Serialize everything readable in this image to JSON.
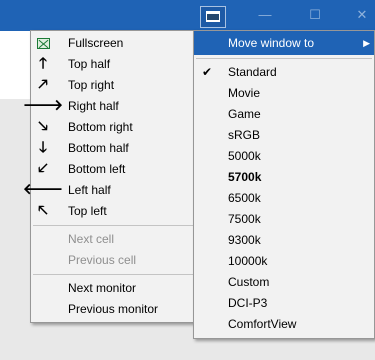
{
  "left_menu": {
    "items": [
      {
        "label": "Fullscreen",
        "icon": "fullscreen-icon"
      },
      {
        "label": "Top half",
        "icon": "arrow-up-icon"
      },
      {
        "label": "Top right",
        "icon": "arrow-up-right-icon"
      },
      {
        "label": "Right half",
        "icon": "arrow-right-icon"
      },
      {
        "label": "Bottom right",
        "icon": "arrow-down-right-icon"
      },
      {
        "label": "Bottom half",
        "icon": "arrow-down-icon"
      },
      {
        "label": "Bottom left",
        "icon": "arrow-down-left-icon"
      },
      {
        "label": "Left half",
        "icon": "arrow-left-icon"
      },
      {
        "label": "Top left",
        "icon": "arrow-up-left-icon"
      },
      {
        "label": "Next cell",
        "disabled": true
      },
      {
        "label": "Previous cell",
        "disabled": true
      },
      {
        "label": "Next monitor"
      },
      {
        "label": "Previous monitor"
      }
    ]
  },
  "right_menu": {
    "header": "Move window to",
    "items": [
      {
        "label": "Standard",
        "checked": true
      },
      {
        "label": "Movie"
      },
      {
        "label": "Game"
      },
      {
        "label": "sRGB"
      },
      {
        "label": "5000k"
      },
      {
        "label": "5700k",
        "bold": true
      },
      {
        "label": "6500k"
      },
      {
        "label": "7500k"
      },
      {
        "label": "9300k"
      },
      {
        "label": "10000k"
      },
      {
        "label": "Custom"
      },
      {
        "label": "DCI-P3"
      },
      {
        "label": "ComfortView"
      }
    ]
  },
  "colors": {
    "highlight": "#1f63b5",
    "menu_bg": "#f2f2f2",
    "disabled_text": "#8f8f8f",
    "icon_green": "#1b7a36"
  }
}
